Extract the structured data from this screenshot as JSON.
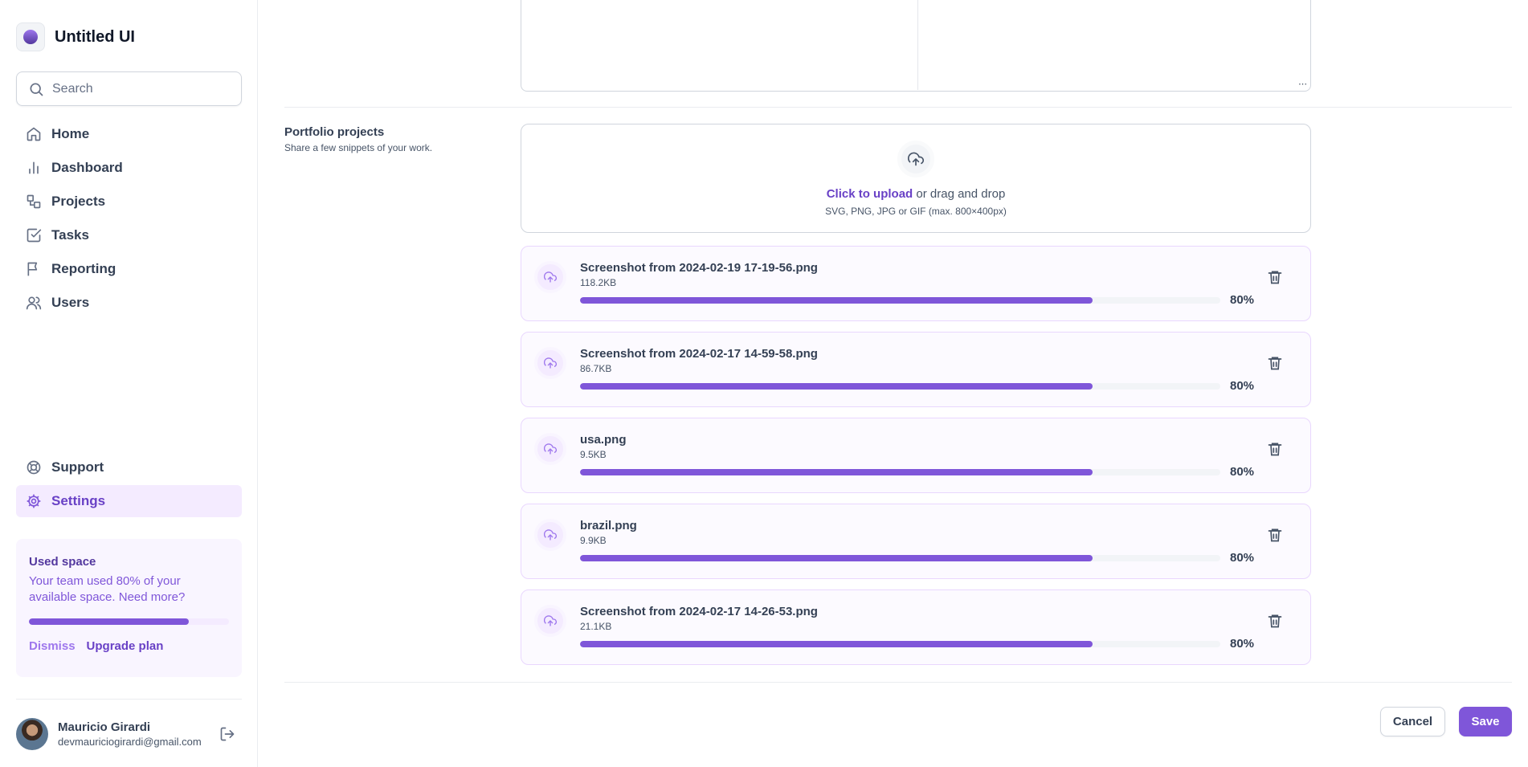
{
  "app": {
    "name": "Untitled UI"
  },
  "search": {
    "placeholder": "Search"
  },
  "nav_top": [
    {
      "label": "Home",
      "icon": "home-icon"
    },
    {
      "label": "Dashboard",
      "icon": "bar-chart-icon"
    },
    {
      "label": "Projects",
      "icon": "layers-icon"
    },
    {
      "label": "Tasks",
      "icon": "check-square-icon"
    },
    {
      "label": "Reporting",
      "icon": "flag-icon"
    },
    {
      "label": "Users",
      "icon": "users-icon"
    }
  ],
  "nav_bottom": [
    {
      "label": "Support",
      "icon": "life-buoy-icon"
    },
    {
      "label": "Settings",
      "icon": "gear-icon",
      "active": true
    }
  ],
  "used_space": {
    "title": "Used space",
    "description": "Your team used 80% of your available space. Need more?",
    "percent": 80,
    "dismiss_label": "Dismiss",
    "upgrade_label": "Upgrade plan"
  },
  "account": {
    "name": "Mauricio Girardi",
    "email": "devmauriciogirardi@gmail.com"
  },
  "portfolio": {
    "title": "Portfolio projects",
    "description": "Share a few snippets of your work.",
    "upload_link": "Click to upload",
    "upload_rest": " or drag and drop",
    "upload_hint": "SVG, PNG, JPG or GIF (max. 800×400px)"
  },
  "files": [
    {
      "name": "Screenshot from 2024-02-19 17-19-56.png",
      "size": "118.2KB",
      "progress": 80,
      "progress_label": "80%"
    },
    {
      "name": "Screenshot from 2024-02-17 14-59-58.png",
      "size": "86.7KB",
      "progress": 80,
      "progress_label": "80%"
    },
    {
      "name": "usa.png",
      "size": "9.5KB",
      "progress": 80,
      "progress_label": "80%"
    },
    {
      "name": "brazil.png",
      "size": "9.9KB",
      "progress": 80,
      "progress_label": "80%"
    },
    {
      "name": "Screenshot from 2024-02-17 14-26-53.png",
      "size": "21.1KB",
      "progress": 80,
      "progress_label": "80%"
    }
  ],
  "actions": {
    "cancel_label": "Cancel",
    "save_label": "Save"
  },
  "colors": {
    "accent": "#7F56D9",
    "accent_dark": "#6941C6",
    "accent_light": "#F4EBFF"
  }
}
